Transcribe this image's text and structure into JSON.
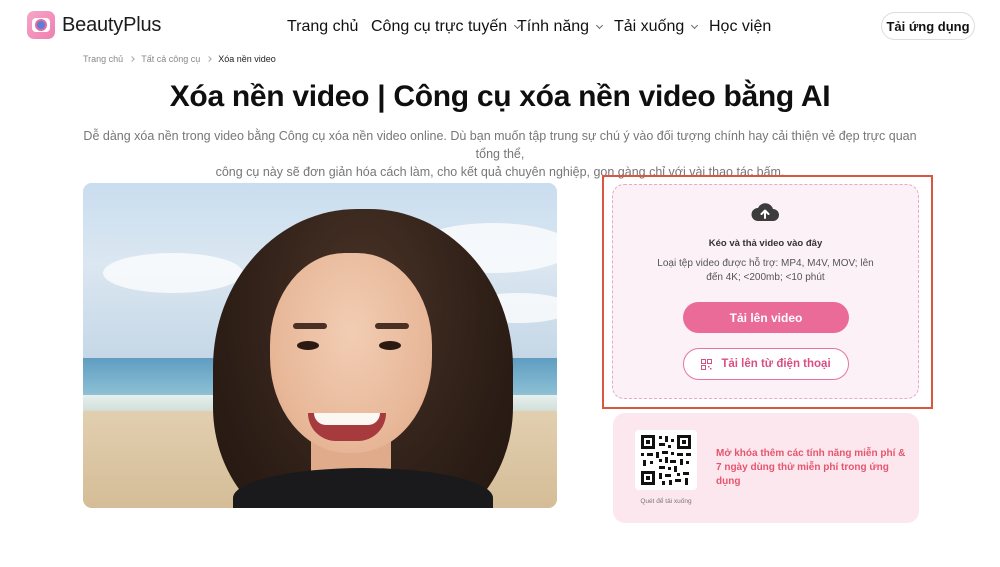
{
  "brand": {
    "name": "BeautyPlus"
  },
  "nav": {
    "items": [
      {
        "label": "Trang chủ",
        "dropdown": false
      },
      {
        "label": "Công cụ trực tuyến",
        "dropdown": true
      },
      {
        "label": "Tính năng",
        "dropdown": true
      },
      {
        "label": "Tải xuống",
        "dropdown": true
      },
      {
        "label": "Học viện",
        "dropdown": false
      }
    ],
    "app_button": "Tải ứng dụng"
  },
  "breadcrumb": [
    "Trang chủ",
    "Tất cả công cụ",
    "Xóa nền video"
  ],
  "hero": {
    "title": "Xóa nền video | Công cụ xóa nền video bằng AI",
    "subtitle_line1": "Dễ dàng xóa nền trong video bằng Công cụ xóa nền video online. Dù bạn muốn tập trung sự chú ý vào đối tượng chính hay cải thiện vẻ đẹp trực quan tổng thể,",
    "subtitle_line2": "công cụ này sẽ đơn giản hóa cách làm, cho kết quả chuyên nghiệp, gọn gàng chỉ với vài thao tác bấm."
  },
  "upload": {
    "drop_title": "Kéo và thả video vào đây",
    "supported_info": "Loại tệp video được hỗ trợ: MP4, M4V, MOV; lên đến 4K; <200mb; <10 phút",
    "upload_button": "Tải lên video",
    "phone_button": "Tải lên từ điện thoại",
    "icon": "cloud-upload-icon"
  },
  "promo": {
    "qr_caption": "Quét để tải xuống",
    "text": "Mở khóa thêm các tính năng miễn phí & 7 ngày dùng thử miễn phí trong ứng dụng"
  },
  "colors": {
    "accent": "#ea6a98",
    "accent_text": "#d94f84",
    "promo_text": "#e4566e",
    "upload_bg": "#fcf1f6",
    "promo_bg": "#fde7ef",
    "highlight_frame": "#d9573e"
  }
}
